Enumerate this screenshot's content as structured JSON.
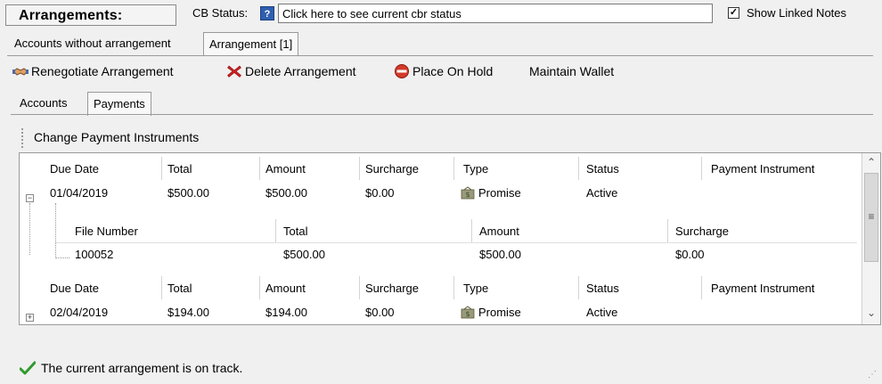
{
  "header": {
    "title": "Arrangements:",
    "cb_status_label": "CB Status:",
    "cb_status_value": "Click here to see current cbr status",
    "show_linked_notes_label": "Show Linked Notes",
    "show_linked_notes_checked": true
  },
  "tabs": [
    {
      "label": "Accounts without arrangement",
      "active": false
    },
    {
      "label": "Arrangement [1]",
      "active": true
    }
  ],
  "toolbar": {
    "renegotiate": "Renegotiate Arrangement",
    "delete": "Delete Arrangement",
    "hold": "Place On Hold",
    "wallet": "Maintain Wallet"
  },
  "subtabs": [
    {
      "label": "Accounts",
      "active": false
    },
    {
      "label": "Payments",
      "active": true
    }
  ],
  "panel": {
    "title": "Change Payment Instruments"
  },
  "grid": {
    "columns": [
      "Due Date",
      "Total",
      "Amount",
      "Surcharge",
      "Type",
      "Status",
      "Payment Instrument"
    ],
    "rows": [
      {
        "due_date": "01/04/2019",
        "total": "$500.00",
        "amount": "$500.00",
        "surcharge": "$0.00",
        "type": "Promise",
        "status": "Active",
        "payment_instrument": "",
        "expanded": true
      },
      {
        "due_date": "02/04/2019",
        "total": "$194.00",
        "amount": "$194.00",
        "surcharge": "$0.00",
        "type": "Promise",
        "status": "Active",
        "payment_instrument": "",
        "expanded": false
      }
    ],
    "detail_columns": [
      "File Number",
      "Total",
      "Amount",
      "Surcharge"
    ],
    "detail_row": {
      "file_number": "100052",
      "total": "$500.00",
      "amount": "$500.00",
      "surcharge": "$0.00"
    }
  },
  "footer": {
    "status": "The current arrangement is on track."
  },
  "icons": {
    "renegotiate": "handshake-icon",
    "delete": "red-x-icon",
    "hold": "stop-sign-icon",
    "promise": "money-bag-icon",
    "status_ok": "green-check-icon"
  },
  "colors": {
    "delete": "#d21f1f",
    "hold": "#d23a2a",
    "ok": "#2e9b2e",
    "cb_icon": "#2f5fb0"
  }
}
